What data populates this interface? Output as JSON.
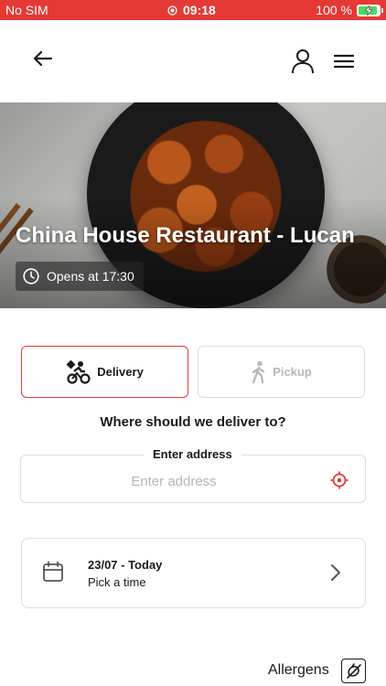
{
  "status_bar": {
    "carrier": "No SIM",
    "time": "09:18",
    "battery": "100 %",
    "battery_level": 1.0,
    "bar_color": "#e53935"
  },
  "header": {
    "back_icon": "arrow-left-icon",
    "account_icon": "user-icon",
    "menu_icon": "hamburger-menu-icon"
  },
  "restaurant": {
    "name": "China House Restaurant - Lucan",
    "hours": "Opens at 17:30",
    "clock_icon": "clock-icon"
  },
  "order_mode": {
    "delivery_label": "Delivery",
    "pickup_label": "Pickup",
    "selected": "Delivery",
    "accent": "#e53935"
  },
  "address": {
    "question": "Where should we deliver to?",
    "legend": "Enter address",
    "value": "",
    "placeholder": "Enter address",
    "locate_icon": "crosshair-icon"
  },
  "schedule": {
    "date": "23/07 - Today",
    "prompt": "Pick a time",
    "calendar_icon": "calendar-icon",
    "chevron_icon": "chevron-right-icon"
  },
  "allergens": {
    "label": "Allergens",
    "icon": "allergen-icon"
  }
}
